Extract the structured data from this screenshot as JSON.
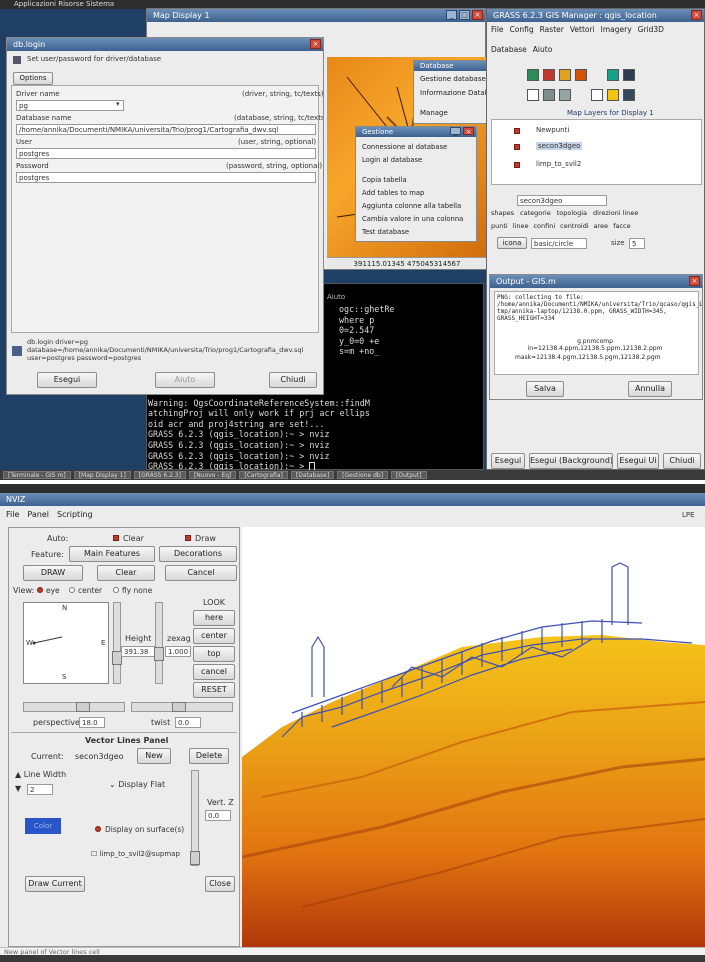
{
  "top": {
    "topbar_text": "Applicazioni  Risorse  Sistema",
    "terminal_lines": [
      "ogc::ghetRe",
      "where p",
      "0=2.547",
      "y_0=0 +e",
      "s=m +no_",
      "ters",
      "Warning: QgsCoordinateReferenceSystem::findM",
      "atchingProj will only work if prj acr ellips",
      "oid acr and proj4string are set!...",
      "GRASS 6.2.3 (qgis_location):~ > nviz",
      "GRASS 6.2.3 (qgis_location):~ > nviz",
      "GRASS 6.2.3 (qgis_location):~ > nviz",
      "GRASS 6.2.3 (qgis_location):~ > "
    ],
    "terminal_menu": "Aiuto",
    "map_display": {
      "title": "Map Display 1",
      "coords": "391115.01345 475045314567"
    },
    "db_login": {
      "title": "db.login",
      "subtitle": "Set user/password for driver/database",
      "tab": "Options",
      "driver_label": "Driver name",
      "driver_hint": "(driver, string, tc/texts)",
      "driver_value": "pg",
      "database_label": "Database name",
      "database_hint": "(database, string, tc/texts)",
      "database_value": "/home/annika/Documenti/NMIKA/universita/Trio/prog1/Cartografia_dwv.sql",
      "user_label": "User",
      "user_hint": "(user, string, optional)",
      "user_value": "postgres",
      "password_label": "Password",
      "password_hint": "(password, string, optional)",
      "password_value": "postgres",
      "cmd_text": "db.login driver=pg database=/home/annika/Documenti/NMIKA/universita/Trio/prog1/Cartografia_dwv.sql user=postgres password=postgres",
      "run_button": "Esegui",
      "help_button": "Aiuto",
      "close_button": "Chiudi"
    },
    "database_menu": {
      "title": "Database",
      "items": [
        "Gestione database",
        "Informazione Database",
        "Manage"
      ]
    },
    "database_submenu": {
      "title": "Gestione",
      "items": [
        "Connessione al database",
        "Login al database",
        "Copia tabella",
        "Add tables to map",
        "Aggiunta colonne alla tabella",
        "Cambia valore in una colonna",
        "Test database"
      ]
    },
    "grass_manager": {
      "title": "GRASS 6.2.3 GIS Manager : qgis_location",
      "menu": [
        "File",
        "Config",
        "Raster",
        "Vettori",
        "Imagery",
        "Grid3D"
      ],
      "menu2": [
        "Database",
        "Aiuto"
      ],
      "layers_title": "Map Layers for Display 1",
      "layers": [
        "Newpunti",
        "secon3dgeo",
        "limp_to_svil2"
      ],
      "map_field": "secon3dgeo",
      "options_row1": [
        "shapes",
        "categorie",
        "topologia",
        "direzioni linee"
      ],
      "options_row2": [
        "punti",
        "linee",
        "confini",
        "centroidi",
        "aree",
        "facce"
      ],
      "icon_label": "icona",
      "icon_value": "basic/circle",
      "size_label": "size",
      "size_value": "5",
      "buttons": [
        "Esegui",
        "Esegui (Background)",
        "Esegui Ui",
        "Chiudi"
      ]
    },
    "output": {
      "title": "Output - GIS.m",
      "text": "PNG: collecting to file: /home/annika/Documenti/NMIKA/universita/Trio/qcaso/qgis_Location/qgis_m/ tmp/annika-laptop/12138.0.ppm, GRASS_WIDTH=345, GRASS_HEIGHT=334",
      "sub1": "g.pnmcomp in=12138.4.ppm,12138.5.ppm,12138.2.ppm",
      "sub2": "mask=12138.4.pgm,12138.5.pgm,12138.2.pgm",
      "buttons": [
        "Salva",
        "Annulla"
      ]
    },
    "tasks": [
      "[Terminale - GIS m]",
      "[Map Display 1]",
      "[GRASS 6.2.3]",
      "[Nuovo - Eq]",
      "[Cartografia]",
      "[Database]",
      "[Gestione db]",
      "[Output]"
    ]
  },
  "nviz": {
    "title": "NVIZ",
    "menu": [
      "File",
      "Panel",
      "Scripting"
    ],
    "auto_label": "Auto:",
    "clear_label": "Clear",
    "draw_label": "Draw",
    "feature_label": "Feature:",
    "feature_value": "Main Features",
    "decorations_value": "Decorations",
    "buttons_row": [
      "DRAW",
      "Clear",
      "Cancel"
    ],
    "view_label": "View:",
    "view_options": [
      "eye",
      "center",
      "fly none"
    ],
    "compass_n": "N",
    "compass_s": "S",
    "compass_e": "E",
    "compass_w": "W",
    "height_label": "Height",
    "height_value": "391.38",
    "zexag_label": "zexag",
    "zexag_value": "1.000",
    "look_label": "LOOK",
    "look_buttons": [
      "here",
      "center",
      "top",
      "cancel",
      "RESET"
    ],
    "perspective_label": "perspective",
    "perspective_value": "18.0",
    "twist_label": "twist",
    "twist_value": "0.0",
    "vector_panel_title": "Vector Lines Panel",
    "current_label": "Current:",
    "current_value": "secon3dgeo",
    "new_button": "New",
    "delete_button": "Delete",
    "line_width_label": "Line Width",
    "line_width_value": "2",
    "display_flat_label": "Display Flat",
    "display_surface_label": "Display on surface(s)",
    "surface_name": "limp_to_svil2@supmap",
    "vert_label": "Vert. Z",
    "vert_value": "0.0",
    "color_label": "Color",
    "draw_current_button": "Draw Current",
    "close_button": "Close",
    "status": "New panel of Vector lines cell",
    "right_label": "LPE"
  },
  "colors": {
    "terrain_low": "#b0370a",
    "terrain_mid": "#e27410",
    "terrain_high": "#f5c31a",
    "vector_lines": "#3e4fb3",
    "desktop": "#1f3f64",
    "swatch": "#2a55c8"
  }
}
